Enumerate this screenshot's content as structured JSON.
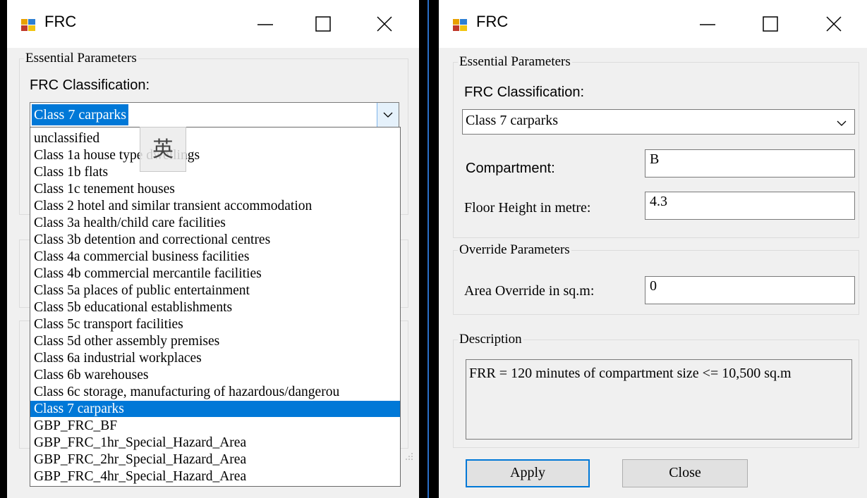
{
  "left_window": {
    "title": "FRC",
    "group_title": "Essential Parameters",
    "classification_label": "FRC Classification:",
    "selected_value": "Class 7 carparks",
    "options": [
      "unclassified",
      "Class 1a house type dwellings",
      "Class 1b flats",
      "Class 1c tenement houses",
      "Class 2 hotel and similar transient accommodation",
      "Class 3a health/child care facilities",
      "Class 3b detention and correctional centres",
      "Class 4a commercial business facilities",
      "Class 4b commercial mercantile facilities",
      "Class 5a places of public entertainment",
      "Class 5b educational establishments",
      "Class 5c transport facilities",
      "Class 5d other assembly premises",
      "Class 6a industrial workplaces",
      "Class 6b warehouses",
      "Class 6c storage, manufacturing of hazardous/dangerou",
      "Class 7 carparks",
      "GBP_FRC_BF",
      "GBP_FRC_1hr_Special_Hazard_Area",
      "GBP_FRC_2hr_Special_Hazard_Area",
      "GBP_FRC_4hr_Special_Hazard_Area"
    ],
    "selected_index": 16,
    "ime_glyph": "英"
  },
  "right_window": {
    "title": "FRC",
    "essential": {
      "group_title": "Essential Parameters",
      "classification_label": "FRC Classification:",
      "classification_value": "Class 7 carparks",
      "compartment_label": "Compartment:",
      "compartment_value": "B",
      "floor_height_label": "Floor Height in metre:",
      "floor_height_value": "4.3"
    },
    "override": {
      "group_title": "Override Parameters",
      "area_label": "Area Override in sq.m:",
      "area_value": "0"
    },
    "description": {
      "group_title": "Description",
      "text": "FRR = 120 minutes of compartment size <= 10,500 sq.m"
    },
    "buttons": {
      "apply": "Apply",
      "close": "Close"
    }
  },
  "colors": {
    "selection": "#0078d7",
    "window_bg": "#f0f0f0",
    "titlebar_bg": "#ffffff"
  },
  "icons": [
    "app-icon",
    "minimize-icon",
    "maximize-icon",
    "close-icon",
    "chevron-down-icon"
  ]
}
